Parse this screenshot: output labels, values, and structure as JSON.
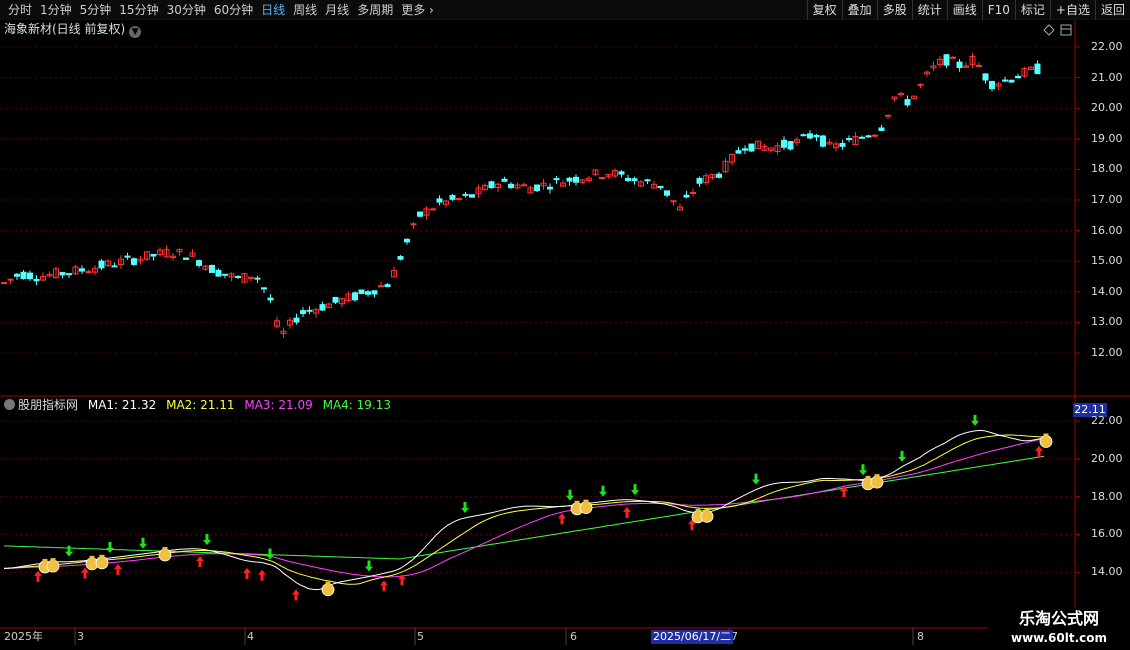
{
  "toolbar": {
    "periods": [
      "分时",
      "1分钟",
      "5分钟",
      "15分钟",
      "30分钟",
      "60分钟",
      "日线",
      "周线",
      "月线",
      "多周期",
      "更多"
    ],
    "active_period": "日线",
    "right_buttons": [
      "复权",
      "叠加",
      "多股",
      "统计",
      "画线",
      "F10",
      "标记",
      "+自选",
      "返回"
    ]
  },
  "main_chart": {
    "title": "海象新材(日线 前复权)",
    "price_ticks": [
      "22.00",
      "21.00",
      "20.00",
      "19.00",
      "18.00",
      "17.00",
      "16.00",
      "15.00",
      "14.00",
      "13.00",
      "12.00"
    ]
  },
  "indicator": {
    "name": "股朋指标网",
    "ma1": "MA1: 21.32",
    "ma2": "MA2: 21.11",
    "ma3": "MA3: 21.09",
    "ma4": "MA4: 19.13",
    "ma1_color": "#ffffff",
    "ma2_color": "#ffff40",
    "ma3_color": "#ff40ff",
    "ma4_color": "#40ff40",
    "current_price": "22.11",
    "ticks": [
      "22.00",
      "20.00",
      "18.00",
      "16.00",
      "14.00"
    ]
  },
  "dates": {
    "labels": [
      "2025年",
      "3",
      "4",
      "5",
      "6",
      "7",
      "8"
    ],
    "cursor": "2025/06/17/二"
  },
  "colors": {
    "up": "#ff3333",
    "down": "#54ffff",
    "grid": "#5a0000",
    "border": "#aa0000"
  },
  "watermark": {
    "title": "乐淘公式网",
    "url": "www.60lt.com"
  }
}
